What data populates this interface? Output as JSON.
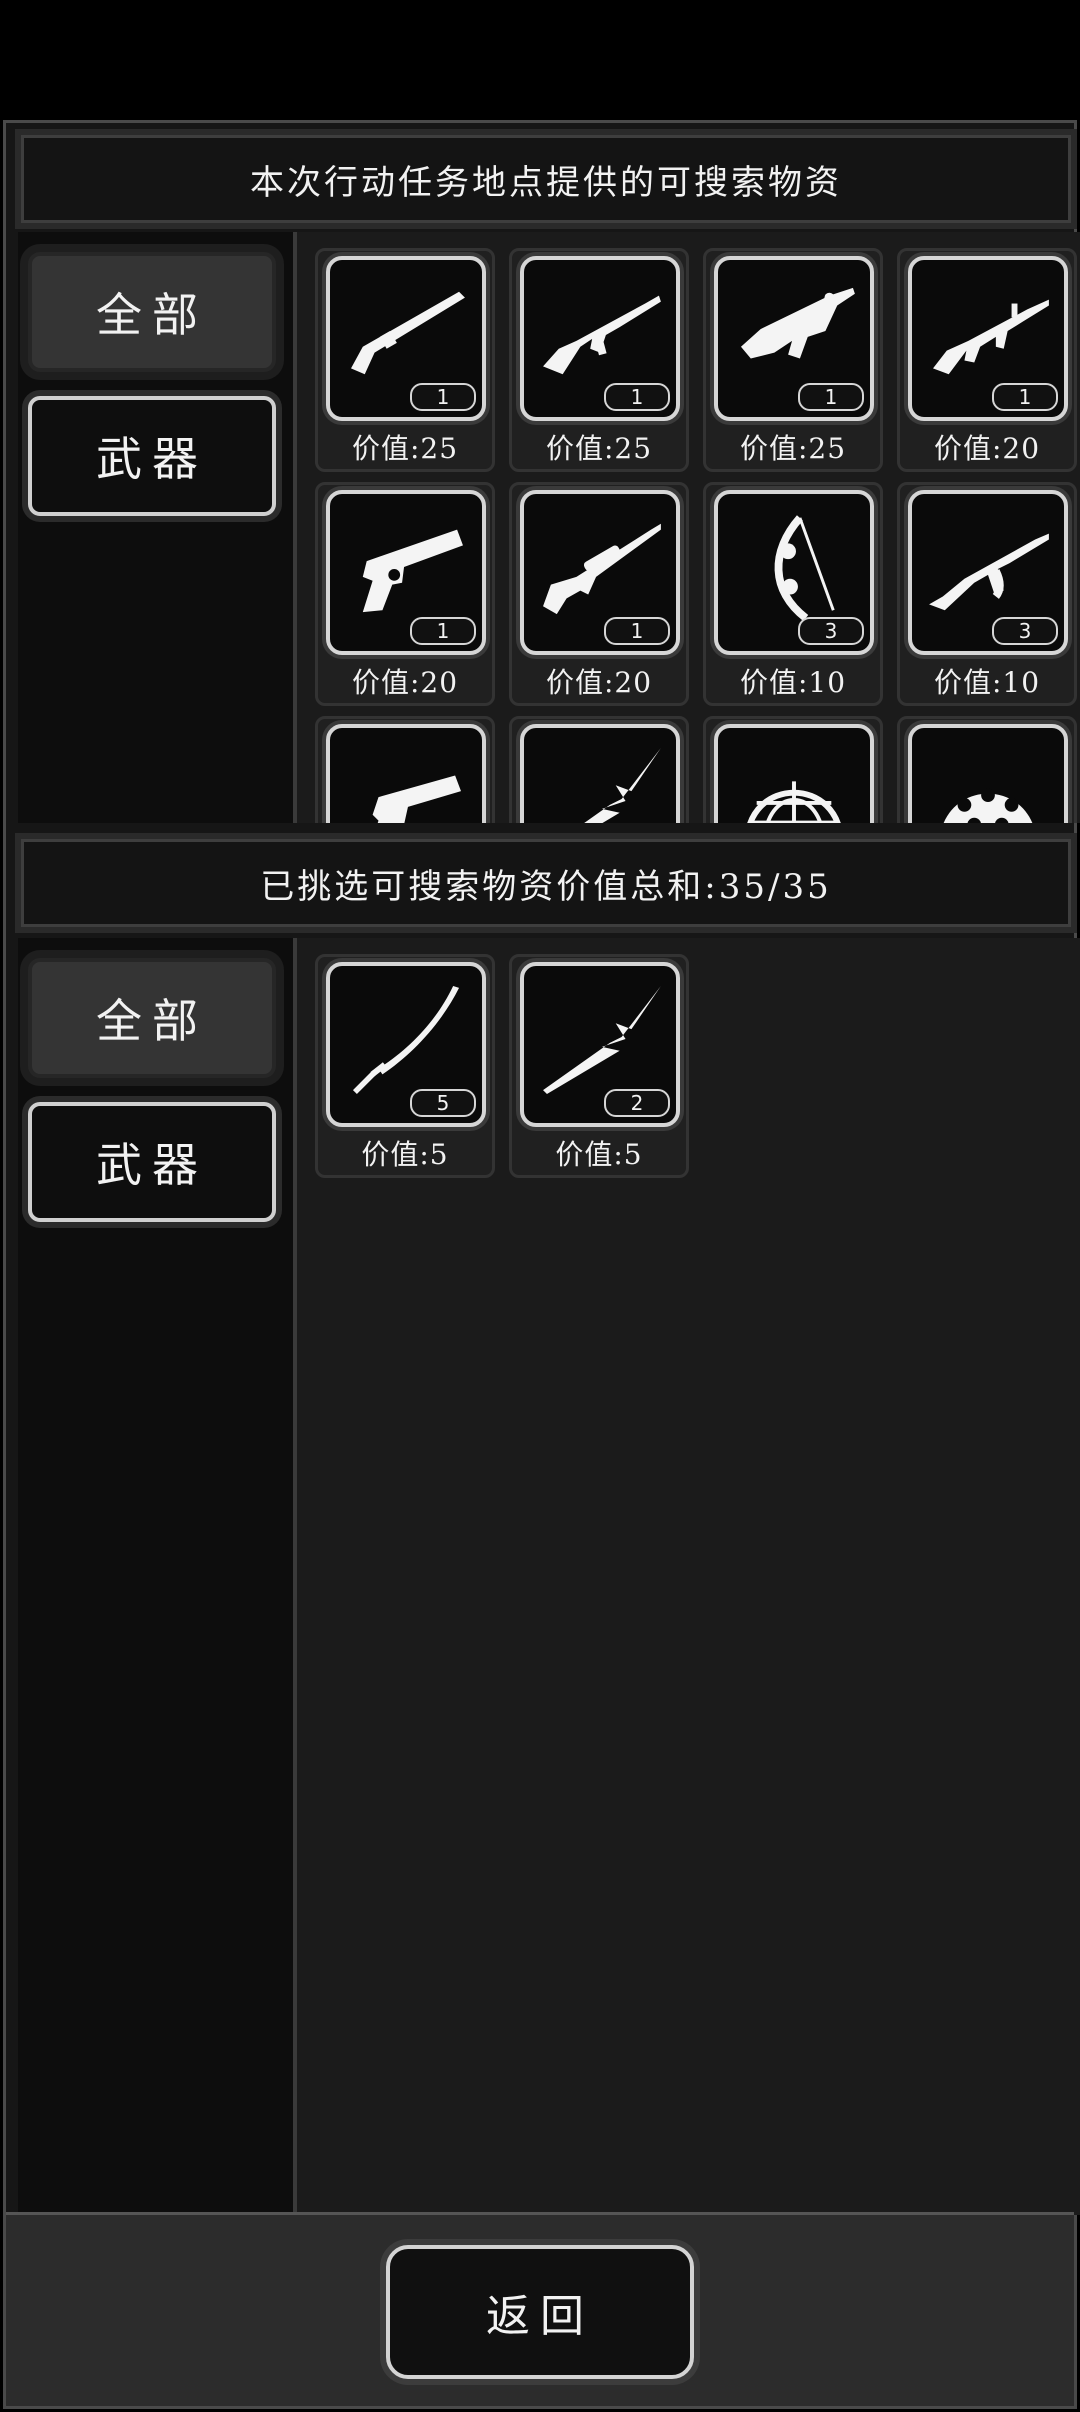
{
  "top_header": "本次行动任务地点提供的可搜索物资",
  "selected_header": "已挑选可搜索物资价值总和:35/35",
  "tabs": {
    "all": "全部",
    "weapons": "武器"
  },
  "available_items": [
    {
      "icon": "shotgun-icon",
      "qty": "1",
      "value": "价值:25"
    },
    {
      "icon": "assault-rifle-icon",
      "qty": "1",
      "value": "价值:25"
    },
    {
      "icon": "bullpup-rifle-icon",
      "qty": "1",
      "value": "价值:25"
    },
    {
      "icon": "m16-rifle-icon",
      "qty": "1",
      "value": "价值:20"
    },
    {
      "icon": "pistol-icon",
      "qty": "1",
      "value": "价值:20"
    },
    {
      "icon": "sniper-rifle-icon",
      "qty": "1",
      "value": "价值:20"
    },
    {
      "icon": "compound-bow-icon",
      "qty": "3",
      "value": "价值:10"
    },
    {
      "icon": "ak-rifle-icon",
      "qty": "3",
      "value": "价值:10"
    },
    {
      "icon": "handgun-icon",
      "qty": "",
      "value": ""
    },
    {
      "icon": "spear-icon",
      "qty": "",
      "value": ""
    },
    {
      "icon": "helmet-net-icon",
      "qty": "",
      "value": ""
    },
    {
      "icon": "helmet-camo-icon",
      "qty": "",
      "value": ""
    }
  ],
  "selected_items": [
    {
      "icon": "katana-icon",
      "qty": "5",
      "value": "价值:5"
    },
    {
      "icon": "spear-icon",
      "qty": "2",
      "value": "价值:5"
    }
  ],
  "back_button": "返回"
}
